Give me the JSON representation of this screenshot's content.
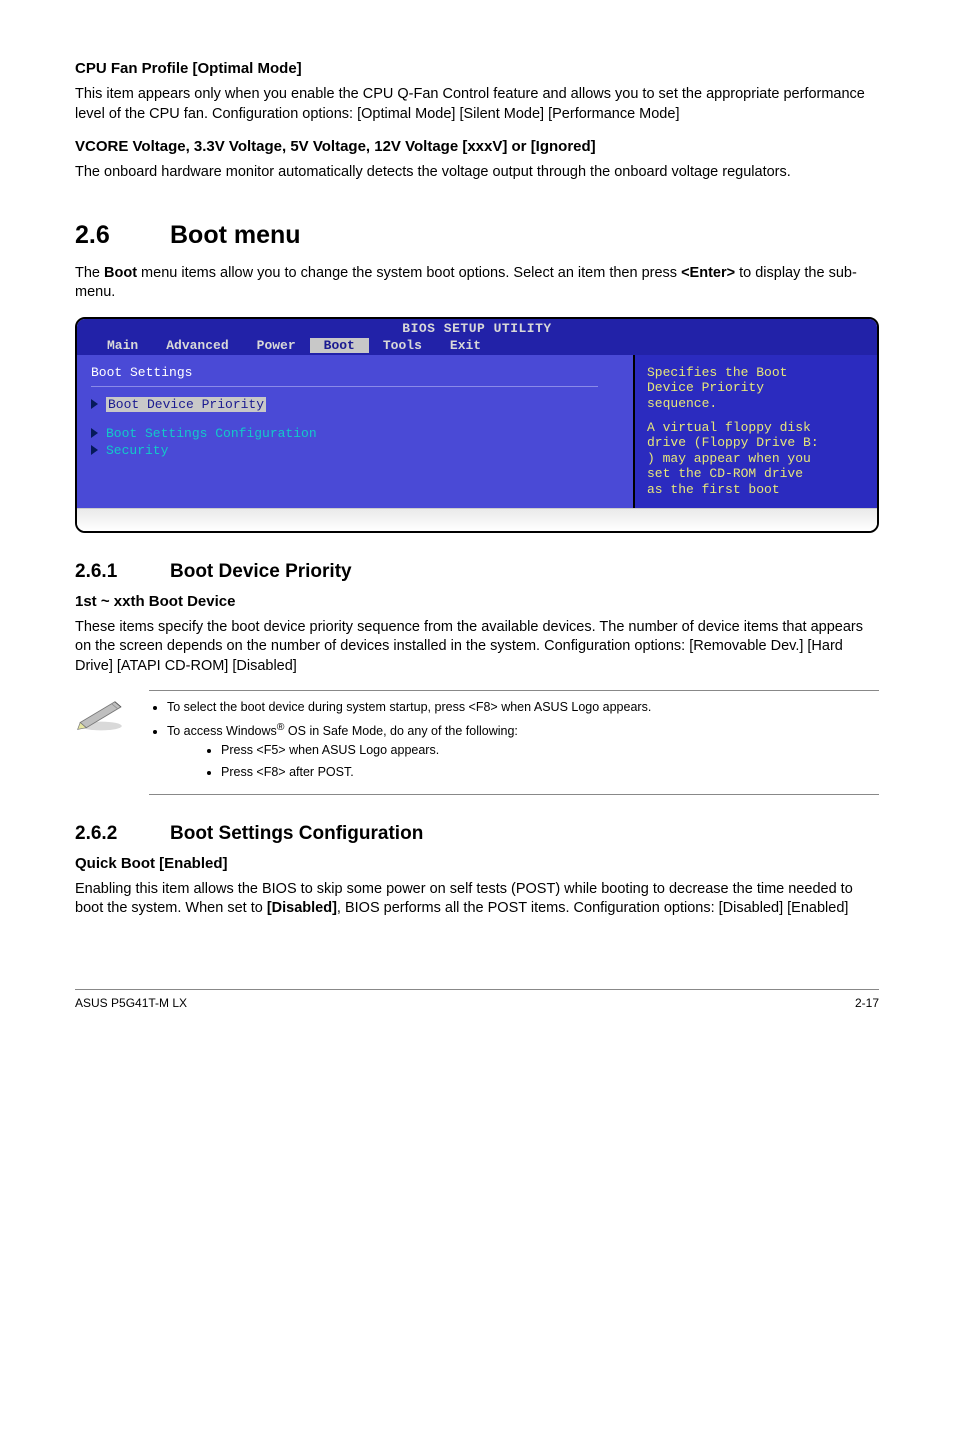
{
  "sec_cpu_fan": {
    "title": "CPU Fan Profile [Optimal Mode]",
    "body": "This item appears only when you enable the CPU Q-Fan Control feature and allows you to set the appropriate performance level of the CPU fan. Configuration options: [Optimal Mode] [Silent Mode] [Performance Mode]"
  },
  "sec_vcore": {
    "title": "VCORE Voltage, 3.3V Voltage, 5V Voltage, 12V Voltage [xxxV] or [Ignored]",
    "body": "The onboard hardware monitor automatically detects the voltage output through the onboard voltage regulators."
  },
  "boot_menu": {
    "num": "2.6",
    "title": "Boot menu",
    "intro_pre": "The ",
    "intro_bold": "Boot",
    "intro_mid": " menu items allow you to change the system boot options. Select an item then press ",
    "intro_bold2": "<Enter>",
    "intro_post": " to display the sub-menu."
  },
  "bios": {
    "title": "BIOS SETUP UTILITY",
    "tabs": [
      "Main",
      "Advanced",
      "Power",
      "Boot",
      "Tools",
      "Exit"
    ],
    "active_tab": "Boot",
    "left": {
      "heading": "Boot Settings",
      "row1": "Boot Device Priority",
      "row2": "Boot Settings Configuration",
      "row3": "Security"
    },
    "right": {
      "line1": "Specifies the Boot",
      "line2": "Device Priority",
      "line3": "sequence.",
      "line4": "A virtual floppy disk",
      "line5": "drive (Floppy Drive B:",
      "line6": ") may appear when you",
      "line7": "set the CD-ROM drive",
      "line8": "as the first boot"
    }
  },
  "sub261": {
    "num": "2.6.1",
    "title": "Boot Device Priority",
    "h": "1st ~ xxth Boot Device",
    "body": "These items specify the boot device priority sequence from the available devices. The number of device items that appears on the screen depends on the number of devices installed in the system. Configuration options: [Removable Dev.] [Hard Drive] [ATAPI CD-ROM] [Disabled]"
  },
  "note": {
    "b1": "To select the boot device during system startup, press <F8> when ASUS Logo appears.",
    "b2_pre": "To access Windows",
    "b2_post": " OS in Safe Mode, do any of the following:",
    "b2a": "Press <F5> when ASUS Logo appears.",
    "b2b": "Press <F8> after POST."
  },
  "sub262": {
    "num": "2.6.2",
    "title": "Boot Settings Configuration",
    "h": "Quick Boot [Enabled]",
    "body_pre": "Enabling this item allows the BIOS to skip some power on self tests (POST) while booting to decrease the time needed to boot the system. When set to ",
    "body_bold": "[Disabled]",
    "body_post": ", BIOS performs all the POST items. Configuration options: [Disabled] [Enabled]"
  },
  "footer": {
    "left": "ASUS P5G41T-M LX",
    "right": "2-17"
  }
}
